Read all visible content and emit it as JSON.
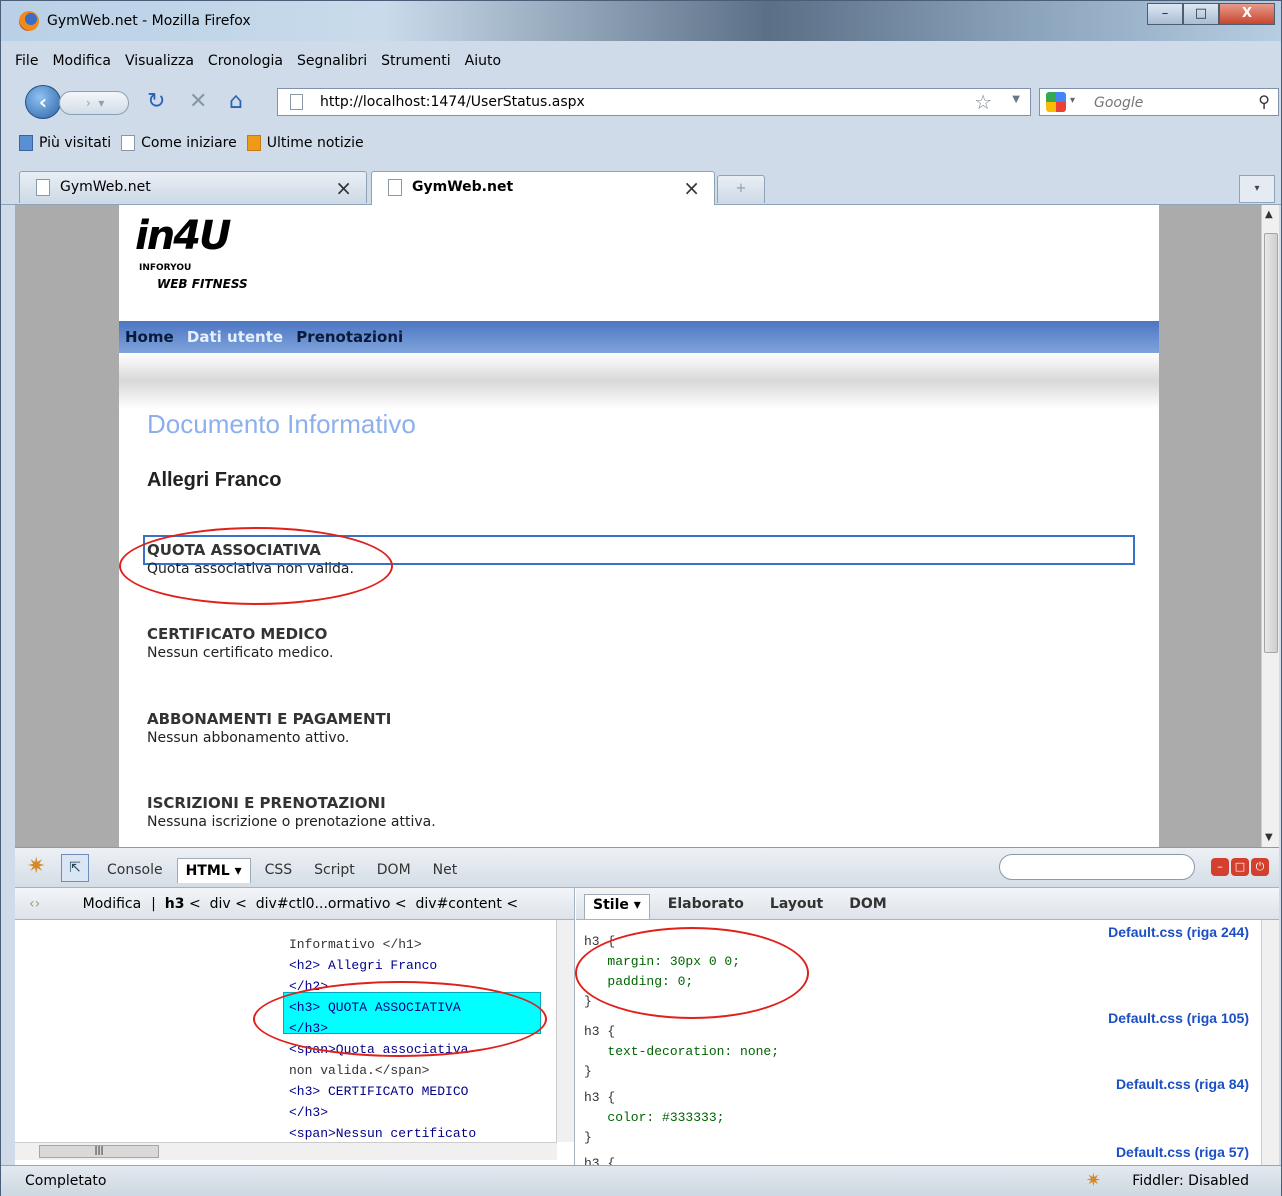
{
  "window": {
    "title": "GymWeb.net - Mozilla Firefox",
    "controls": [
      "–",
      "□",
      "X"
    ]
  },
  "menu": [
    "File",
    "Modifica",
    "Visualizza",
    "Cronologia",
    "Segnalibri",
    "Strumenti",
    "Aiuto"
  ],
  "nav": {
    "url": "http://localhost:1474/UserStatus.aspx",
    "search_placeholder": "Google"
  },
  "bookmarks": [
    "Più visitati",
    "Come iniziare",
    "Ultime notizie"
  ],
  "tabs": [
    {
      "label": "GymWeb.net",
      "active": false
    },
    {
      "label": "GymWeb.net",
      "active": true
    }
  ],
  "site": {
    "logo_text": "in4U",
    "logo_sub": "INFORYOU",
    "logo_tag": "WEB FITNESS",
    "nav": [
      "Home",
      "Dati utente",
      "Prenotazioni"
    ],
    "title": "Documento Informativo",
    "person": "Allegri Franco",
    "sections": [
      {
        "heading": "QUOTA ASSOCIATIVA",
        "text": "Quota associativa non valida."
      },
      {
        "heading": "CERTIFICATO MEDICO",
        "text": "Nessun certificato medico."
      },
      {
        "heading": "ABBONAMENTI E PAGAMENTI",
        "text": "Nessun abbonamento attivo."
      },
      {
        "heading": "ISCRIZIONI E PRENOTAZIONI",
        "text": "Nessuna iscrizione o prenotazione attiva."
      }
    ]
  },
  "firebug": {
    "tabs": [
      "Console",
      "HTML ▾",
      "CSS",
      "Script",
      "DOM",
      "Net"
    ],
    "path": {
      "edit": "Modifica",
      "crumbs": [
        "h3",
        "div",
        "div#ctl0...ormativo",
        "div#content"
      ]
    },
    "html_lines": [
      "Informativo </h1>",
      "<h2> Allegri Franco",
      "</h2>",
      "<h3> QUOTA ASSOCIATIVA",
      "</h3>",
      "<span>Quota associativa",
      "non valida.</span>",
      "<h3> CERTIFICATO MEDICO",
      "</h3>",
      "<span>Nessun certificato"
    ],
    "side_tabs": [
      "Stile ▾",
      "Elaborato",
      "Layout",
      "DOM"
    ],
    "css_rules": [
      {
        "source": "Default.css (riga 244)",
        "selector": "h3 {",
        "props": [
          "margin: 30px 0 0;",
          "padding: 0;"
        ]
      },
      {
        "source": "Default.css (riga 105)",
        "selector": "h3 {",
        "props": [
          "text-decoration: none;"
        ]
      },
      {
        "source": "Default.css (riga 84)",
        "selector": "h3 {",
        "props": [
          "color: #333333;"
        ]
      },
      {
        "source": "Default.css (riga 57)",
        "selector": "h3 {",
        "props": []
      }
    ]
  },
  "status": {
    "text": "Completato",
    "fiddler": "Fiddler: Disabled"
  }
}
